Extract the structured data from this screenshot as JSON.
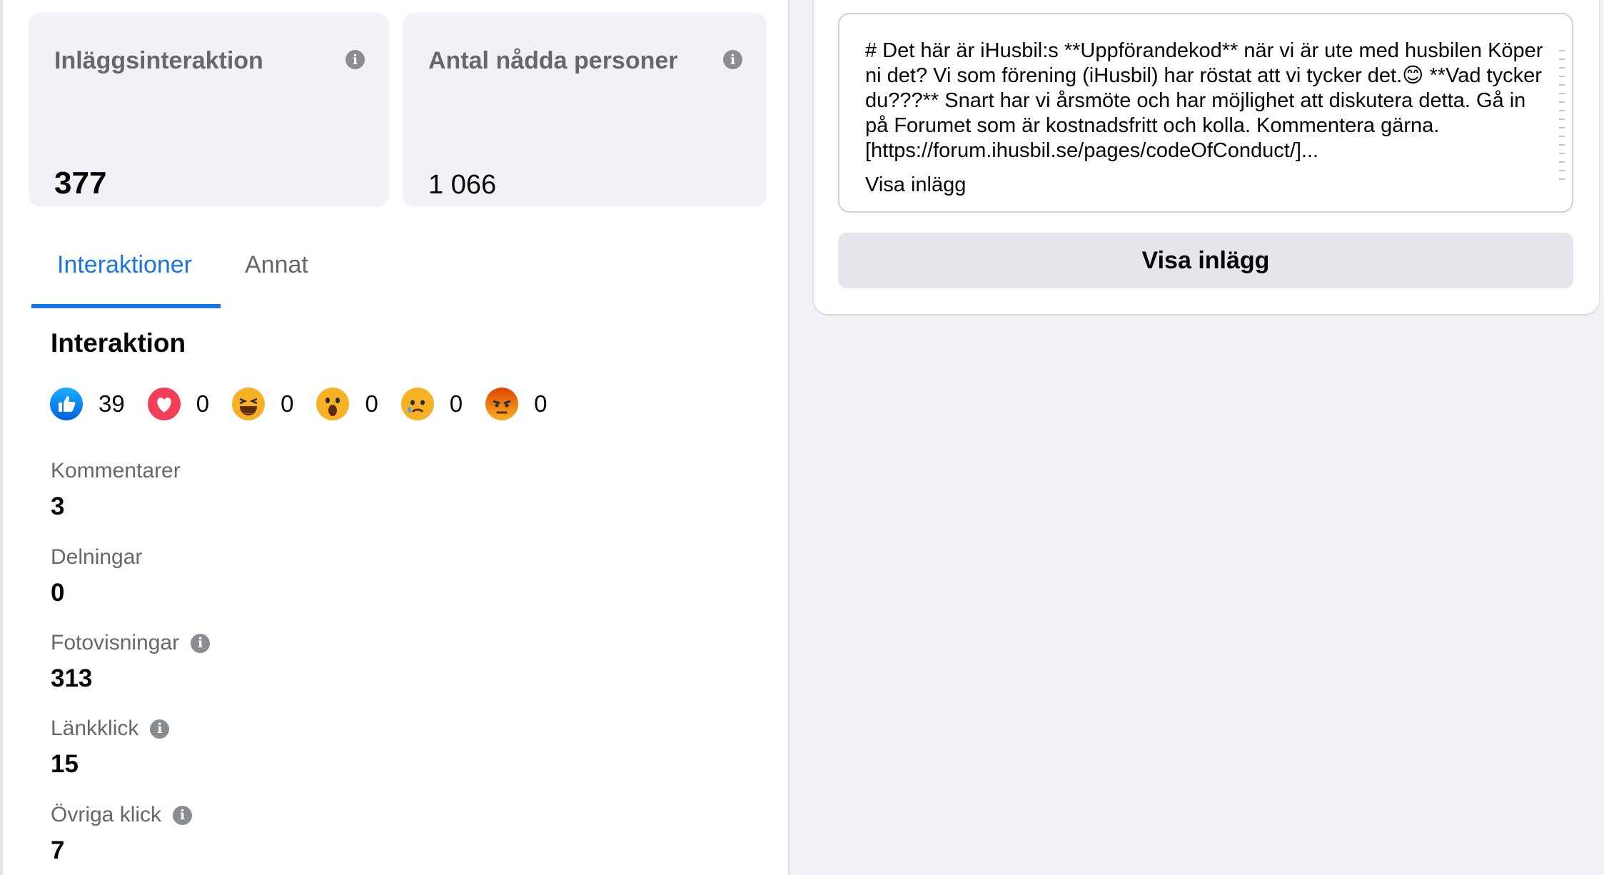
{
  "stats": {
    "post_interactions": {
      "title": "Inläggsinteraktion",
      "value": "377"
    },
    "people_reached": {
      "title": "Antal nådda personer",
      "value": "1 066"
    }
  },
  "tabs": [
    {
      "label": "Interaktioner",
      "active": true
    },
    {
      "label": "Annat",
      "active": false
    }
  ],
  "interaction": {
    "title": "Interaktion",
    "reactions": [
      {
        "icon": "like-reaction-icon",
        "count": "39"
      },
      {
        "icon": "love-reaction-icon",
        "count": "0"
      },
      {
        "icon": "haha-reaction-icon",
        "count": "0"
      },
      {
        "icon": "wow-reaction-icon",
        "count": "0"
      },
      {
        "icon": "sad-reaction-icon",
        "count": "0"
      },
      {
        "icon": "angry-reaction-icon",
        "count": "0"
      }
    ]
  },
  "metrics": [
    {
      "label": "Kommentarer",
      "value": "3",
      "info": false
    },
    {
      "label": "Delningar",
      "value": "0",
      "info": false
    },
    {
      "label": "Fotovisningar",
      "value": "313",
      "info": true
    },
    {
      "label": "Länkklick",
      "value": "15",
      "info": true
    },
    {
      "label": "Övriga klick",
      "value": "7",
      "info": true
    }
  ],
  "post": {
    "text": "# Det här är iHusbil:s **Uppförandekod** när vi är ute med husbilen Köper ni det? Vi som förening (iHusbil) har röstat att vi tycker det.😊 **Vad tycker du???** Snart har vi årsmöte och har möjlighet att diskutera detta. Gå in på Forumet som är kostnadsfritt och kolla. Kommentera gärna. [https://forum.ihusbil.se/pages/codeOfConduct/]...",
    "link_label": "Visa inlägg",
    "button_label": "Visa inlägg"
  },
  "colors": {
    "accent": "#1b74e4",
    "card_bg": "#f0f2f5",
    "muted_text": "#65676b"
  }
}
